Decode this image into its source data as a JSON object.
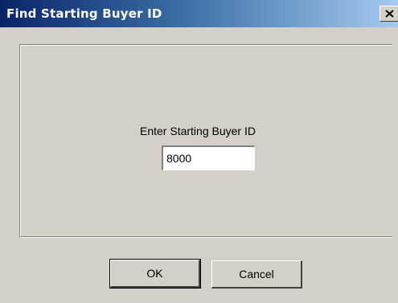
{
  "window": {
    "title": "Find Starting Buyer ID",
    "close_icon": "close-icon",
    "titlebar_colors": [
      "#0a246a",
      "#3a6ea5",
      "#a6caf0"
    ],
    "face_color": "#d4d0c8"
  },
  "form": {
    "prompt_label": "Enter Starting Buyer ID",
    "buyer_id_value": "8000"
  },
  "buttons": {
    "ok_label": "OK",
    "cancel_label": "Cancel"
  }
}
